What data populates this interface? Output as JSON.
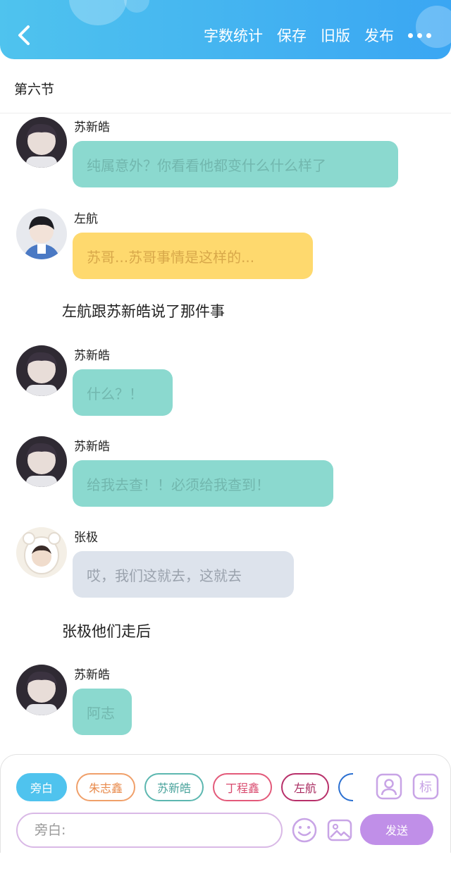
{
  "colors": {
    "header_gradient": [
      "#4fc3ee",
      "#3aa6f3"
    ],
    "teal_bubble": "#8bd9cf",
    "yellow_bubble": "#fed96e",
    "grey_bubble": "#dde3ec",
    "send_button": "#c08fe8",
    "active_chip": "#4fc3ee"
  },
  "header": {
    "back_icon": "chevron-left-icon",
    "actions": [
      {
        "label": "字数统计"
      },
      {
        "label": "保存"
      },
      {
        "label": "旧版"
      },
      {
        "label": "发布"
      }
    ],
    "more_icon": "more-dots-icon"
  },
  "section": {
    "title": "第六节"
  },
  "messages": [
    {
      "type": "dialog",
      "speaker": "苏新皓",
      "text": "纯属意外？你看看他都变什么什么样了",
      "bubble": "teal"
    },
    {
      "type": "dialog",
      "speaker": "左航",
      "text": "苏哥...苏哥事情是这样的...",
      "bubble": "yellow"
    },
    {
      "type": "narration",
      "text": "左航跟苏新皓说了那件事"
    },
    {
      "type": "dialog",
      "speaker": "苏新皓",
      "text": "什么？！",
      "bubble": "teal"
    },
    {
      "type": "dialog",
      "speaker": "苏新皓",
      "text": "给我去查！！必须给我查到！",
      "bubble": "teal"
    },
    {
      "type": "dialog",
      "speaker": "张极",
      "text": "哎，我们这就去，这就去",
      "bubble": "grey"
    },
    {
      "type": "narration",
      "text": "张极他们走后"
    },
    {
      "type": "dialog",
      "speaker": "苏新皓",
      "text": "阿志",
      "bubble": "teal"
    }
  ],
  "composer": {
    "chips": [
      {
        "label": "旁白",
        "active": true
      },
      {
        "label": "朱志鑫"
      },
      {
        "label": "苏新皓"
      },
      {
        "label": "丁程鑫"
      },
      {
        "label": "左航"
      }
    ],
    "role_icon": "person-card-icon",
    "tag_label": "标",
    "input_placeholder": "旁白:",
    "emoji_icon": "smiley-icon",
    "image_icon": "image-icon",
    "send_label": "发送"
  }
}
